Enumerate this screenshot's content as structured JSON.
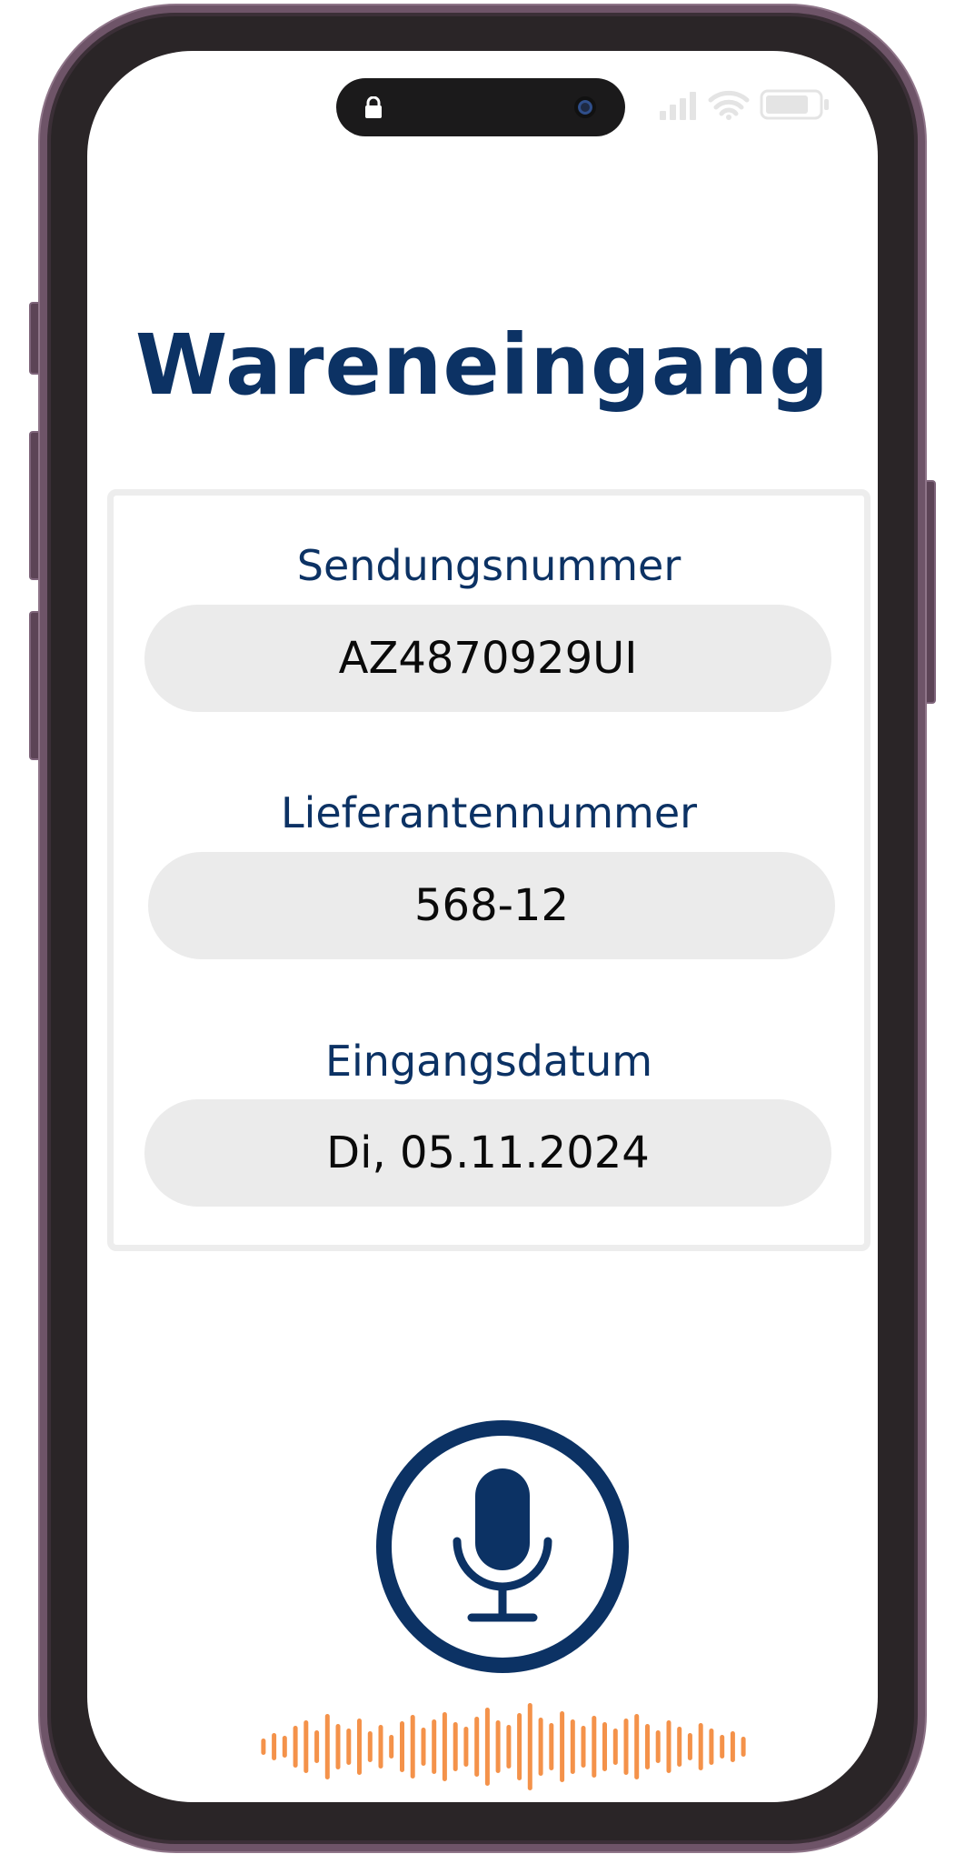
{
  "app": {
    "title": "Wareneingang"
  },
  "form": {
    "fields": [
      {
        "label": "Sendungsnummer",
        "value": "AZ4870929UI"
      },
      {
        "label": "Lieferantennummer",
        "value": "568-12"
      },
      {
        "label": "Eingangsdatum",
        "value": "Di, 05.11.2024"
      }
    ]
  },
  "icons": {
    "lock": "lock-icon",
    "camera": "camera-icon",
    "signal": "cellular-signal-icon",
    "wifi": "wifi-icon",
    "battery": "battery-icon",
    "microphone": "microphone-icon",
    "waveform": "audio-waveform-icon"
  },
  "colors": {
    "primary": "#0c3264",
    "field_background": "#ebebeb",
    "waveform": "#f4924a",
    "phone_frame": "#6e5468"
  }
}
